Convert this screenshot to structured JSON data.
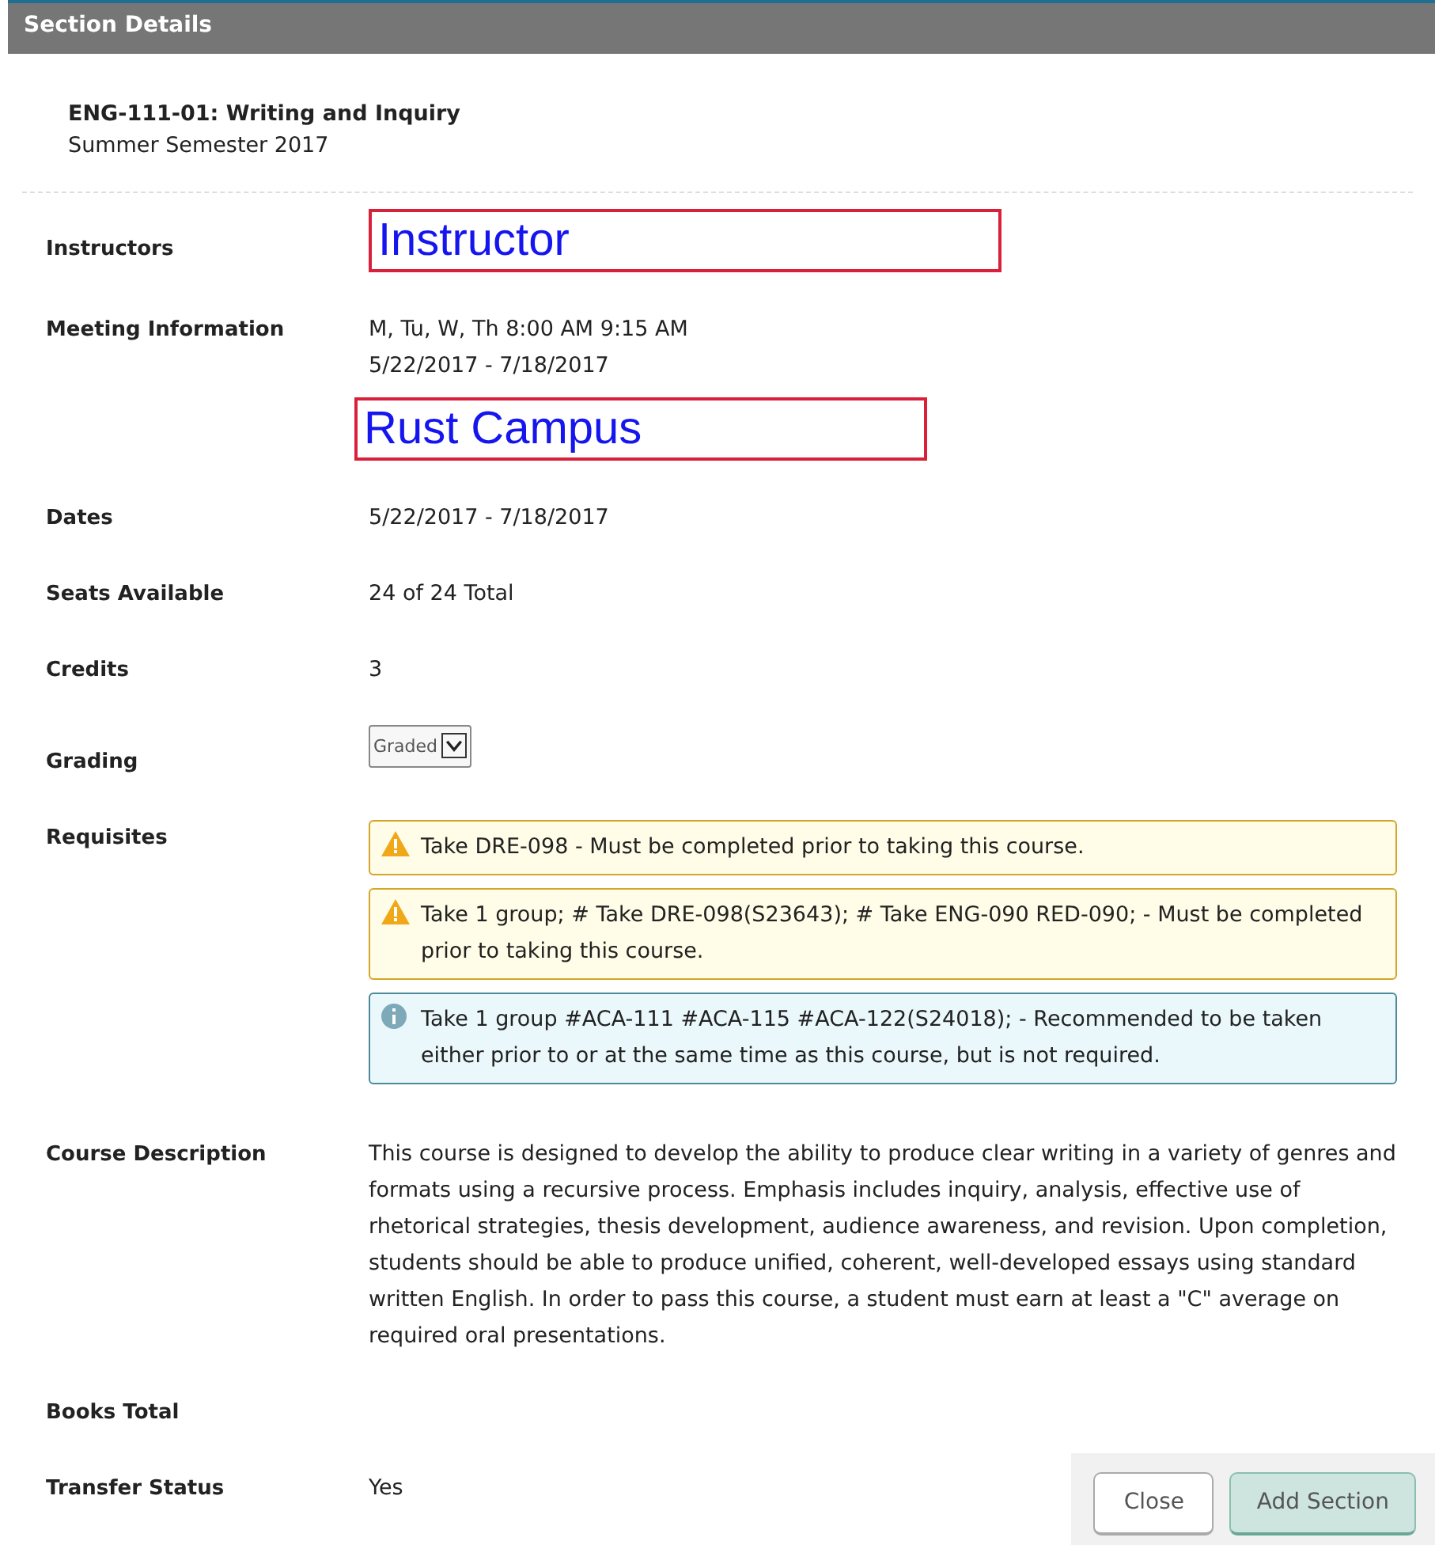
{
  "header": {
    "title": "Section Details"
  },
  "section": {
    "title": "ENG-111-01: Writing and Inquiry",
    "term": "Summer Semester 2017"
  },
  "rows": [
    {
      "label": "Instructors",
      "parts": [
        {
          "kind": "boxed",
          "text": "Instructor"
        }
      ]
    },
    {
      "label": "Meeting Information",
      "parts": [
        {
          "kind": "line",
          "text": "M, Tu, W, Th 8:00 AM 9:15 AM"
        },
        {
          "kind": "line",
          "text": "5/22/2017 - 7/18/2017"
        },
        {
          "kind": "boxed",
          "text": "Rust Campus"
        }
      ]
    },
    {
      "label": "Dates",
      "parts": [
        {
          "kind": "line",
          "text": "5/22/2017 - 7/18/2017"
        }
      ]
    },
    {
      "label": "Seats Available",
      "parts": [
        {
          "kind": "line",
          "text": "24 of 24 Total"
        }
      ]
    },
    {
      "label": "Credits",
      "parts": [
        {
          "kind": "line",
          "text": "3"
        }
      ]
    },
    {
      "label": "Grading",
      "parts": [
        {
          "kind": "select",
          "text": "Graded"
        }
      ]
    },
    {
      "label": "Requisites",
      "parts": [
        {
          "kind": "warning",
          "text": "Take DRE-098 - Must be completed prior to taking this course."
        },
        {
          "kind": "warning",
          "text": "Take 1 group; # Take DRE-098(S23643); # Take ENG-090 RED-090; - Must be completed prior to taking this course."
        },
        {
          "kind": "info",
          "text": "Take 1 group #ACA-111 #ACA-115 #ACA-122(S24018); - Recommended to be taken either prior to or at the same time as this course, but is not required."
        }
      ]
    },
    {
      "label": "Course Description",
      "parts": [
        {
          "kind": "paragraph",
          "text": "This course is designed to develop the ability to produce clear writing in a variety of genres and formats using a recursive process. Emphasis includes inquiry, analysis, effective use of rhetorical strategies, thesis development, audience awareness, and revision. Upon completion, students should be able to produce unified, coherent, well-developed essays using standard written English. In order to pass this course, a student must earn at least a \"C\" average on required oral presentations."
        }
      ]
    },
    {
      "label": "Books Total",
      "parts": []
    },
    {
      "label": "Transfer Status",
      "parts": [
        {
          "kind": "line",
          "text": "Yes"
        }
      ]
    }
  ],
  "buttons": [
    {
      "label": "Close",
      "kind": "secondary"
    },
    {
      "label": "Add Section",
      "kind": "primary"
    }
  ]
}
